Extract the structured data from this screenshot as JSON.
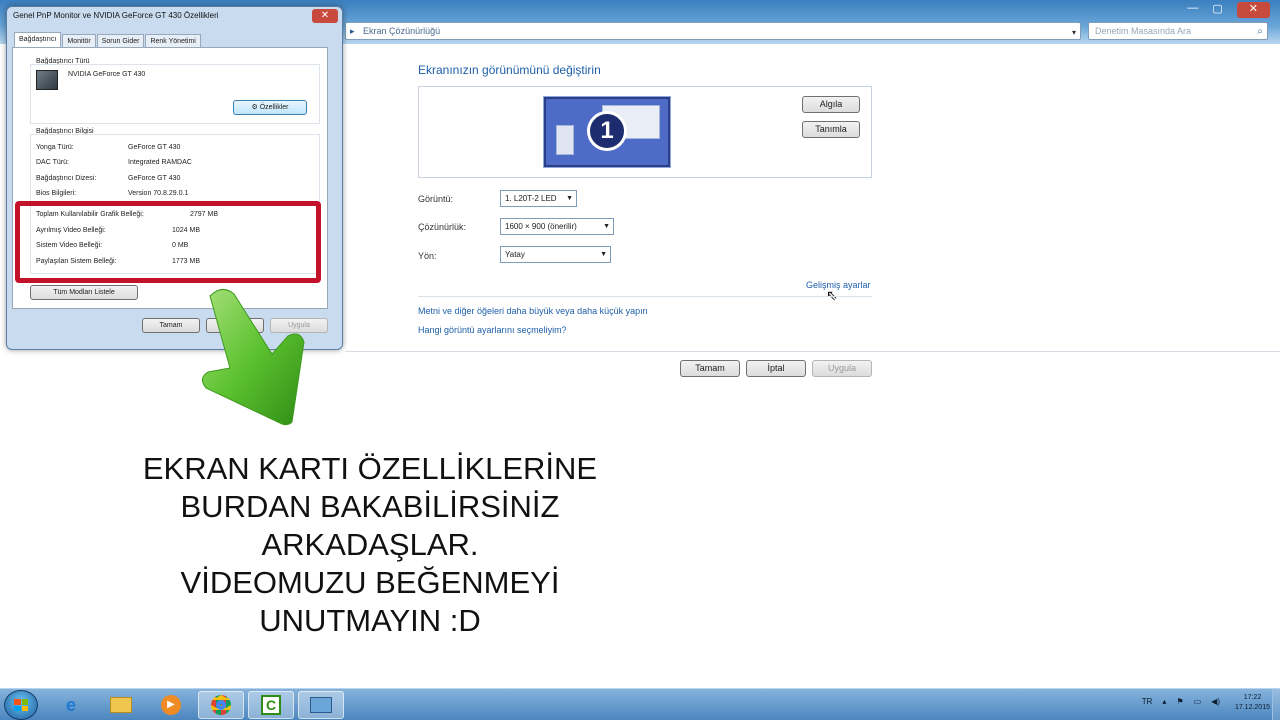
{
  "explorer": {
    "address_text": "Ekran Çözünürlüğü",
    "search_placeholder": "Denetim Masasında Ara",
    "heading": "Ekranınızın görünümünü değiştirin",
    "monitor_number": "1",
    "detect_button": "Algıla",
    "identify_button": "Tanımla",
    "display_label": "Görüntü:",
    "display_value": "1. L20T-2 LED",
    "resolution_label": "Çözünürlük:",
    "resolution_value": "1600 × 900 (önerilir)",
    "orientation_label": "Yön:",
    "orientation_value": "Yatay",
    "advanced_link": "Gelişmiş ayarlar",
    "link_text_size": "Metni ve diğer öğeleri daha büyük veya daha küçük yapın",
    "link_which_settings": "Hangi görüntü ayarlarını seçmeliyim?",
    "ok_button": "Tamam",
    "cancel_button": "İptal",
    "apply_button": "Uygula"
  },
  "dialog": {
    "title": "Genel PnP Monitor ve NVIDIA GeForce GT 430 Özellikleri",
    "tabs": [
      "Bağdaştırıcı",
      "Monitör",
      "Sorun Gider",
      "Renk Yönetimi"
    ],
    "adapter_type_label": "Bağdaştırıcı Türü",
    "adapter_name": "NVIDIA GeForce GT 430",
    "properties_button": "Özellikler",
    "adapter_info_label": "Bağdaştırıcı Bilgisi",
    "info_rows": [
      {
        "label": "Yonga Türü:",
        "value": "GeForce GT 430"
      },
      {
        "label": "DAC Türü:",
        "value": "Integrated RAMDAC"
      },
      {
        "label": "Bağdaştırıcı Dizesi:",
        "value": "GeForce GT 430"
      },
      {
        "label": "Bios Bilgileri:",
        "value": "Version 70.8.29.0.1"
      }
    ],
    "memory_rows": [
      {
        "label": "Toplam Kullanılabilir Grafik Belleği:",
        "value": "2797 MB"
      },
      {
        "label": "Ayrılmış Video Belleği:",
        "value": "1024 MB"
      },
      {
        "label": "Sistem Video Belleği:",
        "value": "0 MB"
      },
      {
        "label": "Paylaşılan Sistem Belleği:",
        "value": "1773 MB"
      }
    ],
    "list_modes_button": "Tüm Modları Listele",
    "ok_button": "Tamam",
    "cancel_button": "İptal",
    "apply_button": "Uygula",
    "highlight_color": "#c4122a"
  },
  "caption": {
    "lines": [
      "EKRAN KARTI ÖZELLİKLERİNE",
      "BURDAN BAKABİLİRSİNİZ",
      "ARKADAŞLAR.",
      "VİDEOMUZU BEĞENMEYİ",
      "UNUTMAYIN :D"
    ]
  },
  "taskbar": {
    "items": [
      "start-button",
      "ie-icon",
      "folder-icon",
      "media-player-icon",
      "chrome-icon",
      "camtasia-icon",
      "control-panel-icon"
    ],
    "language": "TR",
    "time": "17:22",
    "date": "17.12.2015"
  }
}
